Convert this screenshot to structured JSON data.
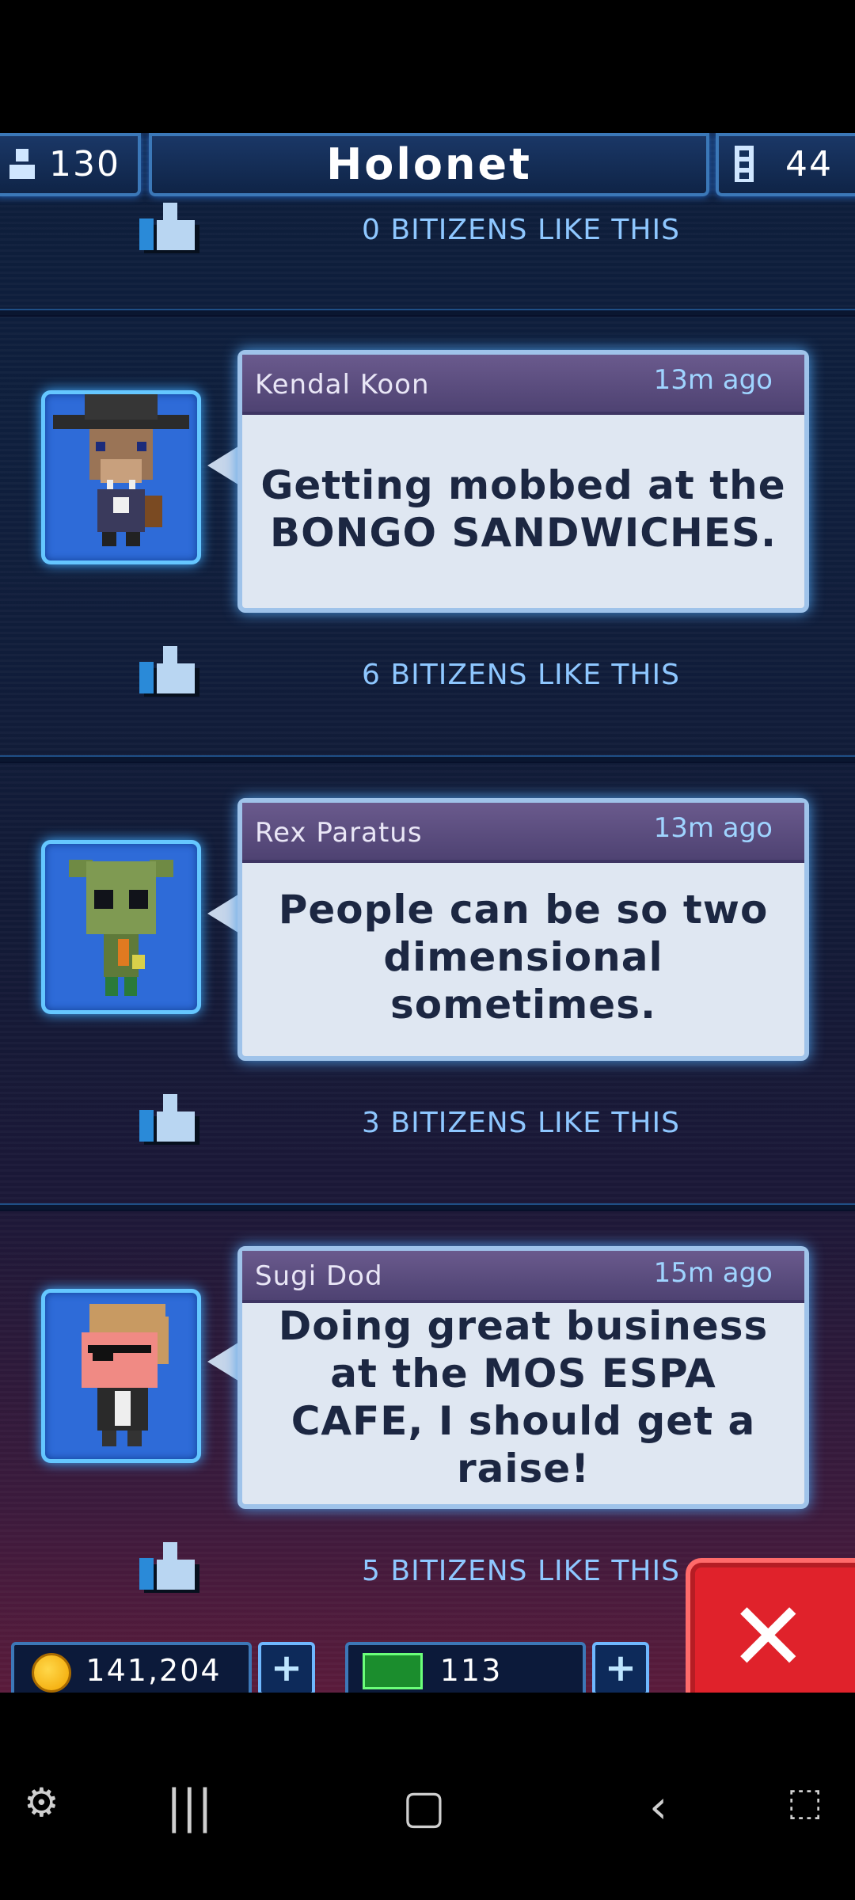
{
  "header": {
    "population": "130",
    "title": "Holonet",
    "floors": "44"
  },
  "feed": [
    {
      "likes_text": "0 BITIZENS LIKE THIS"
    },
    {
      "name": "Kendal Koon",
      "time": "13m ago",
      "message": "Getting mobbed at the BONGO SANDWICHES.",
      "likes_text": "6 BITIZENS LIKE THIS"
    },
    {
      "name": "Rex Paratus",
      "time": "13m ago",
      "message": "People can be so two dimensional sometimes.",
      "likes_text": "3 BITIZENS LIKE THIS"
    },
    {
      "name": "Sugi Dod",
      "time": "15m ago",
      "message": "Doing great business at the MOS ESPA CAFE, I should get a raise!",
      "likes_text": "5 BITIZENS LIKE THIS"
    }
  ],
  "hud": {
    "coins": "141,204",
    "bux": "113"
  },
  "colors": {
    "accent": "#3b78b8",
    "glow": "#65c7ff",
    "close": "#e0222b"
  },
  "icons": [
    "person-icon",
    "elevator-icon",
    "thumbs-up-icon",
    "coin-icon",
    "bux-icon",
    "plus-icon",
    "close-icon"
  ]
}
